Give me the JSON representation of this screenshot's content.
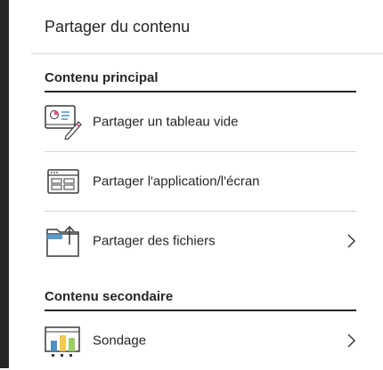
{
  "header": {
    "title": "Partager du contenu"
  },
  "sections": {
    "primary": {
      "title": "Contenu principal",
      "items": [
        {
          "label": "Partager un tableau vide",
          "icon": "whiteboard-icon"
        },
        {
          "label": "Partager l'application/l'écran",
          "icon": "application-window-icon"
        },
        {
          "label": "Partager des fichiers",
          "icon": "folder-upload-icon",
          "has_chevron": true
        }
      ]
    },
    "secondary": {
      "title": "Contenu secondaire",
      "items": [
        {
          "label": "Sondage",
          "icon": "poll-chart-icon",
          "has_chevron": true
        }
      ]
    }
  },
  "colors": {
    "text": "#262626",
    "divider": "#d6d6d6",
    "icon_blue": "#4a90c2",
    "icon_pink": "#e94f8a",
    "icon_yellow": "#f2c94c",
    "icon_green": "#9ccc65"
  }
}
